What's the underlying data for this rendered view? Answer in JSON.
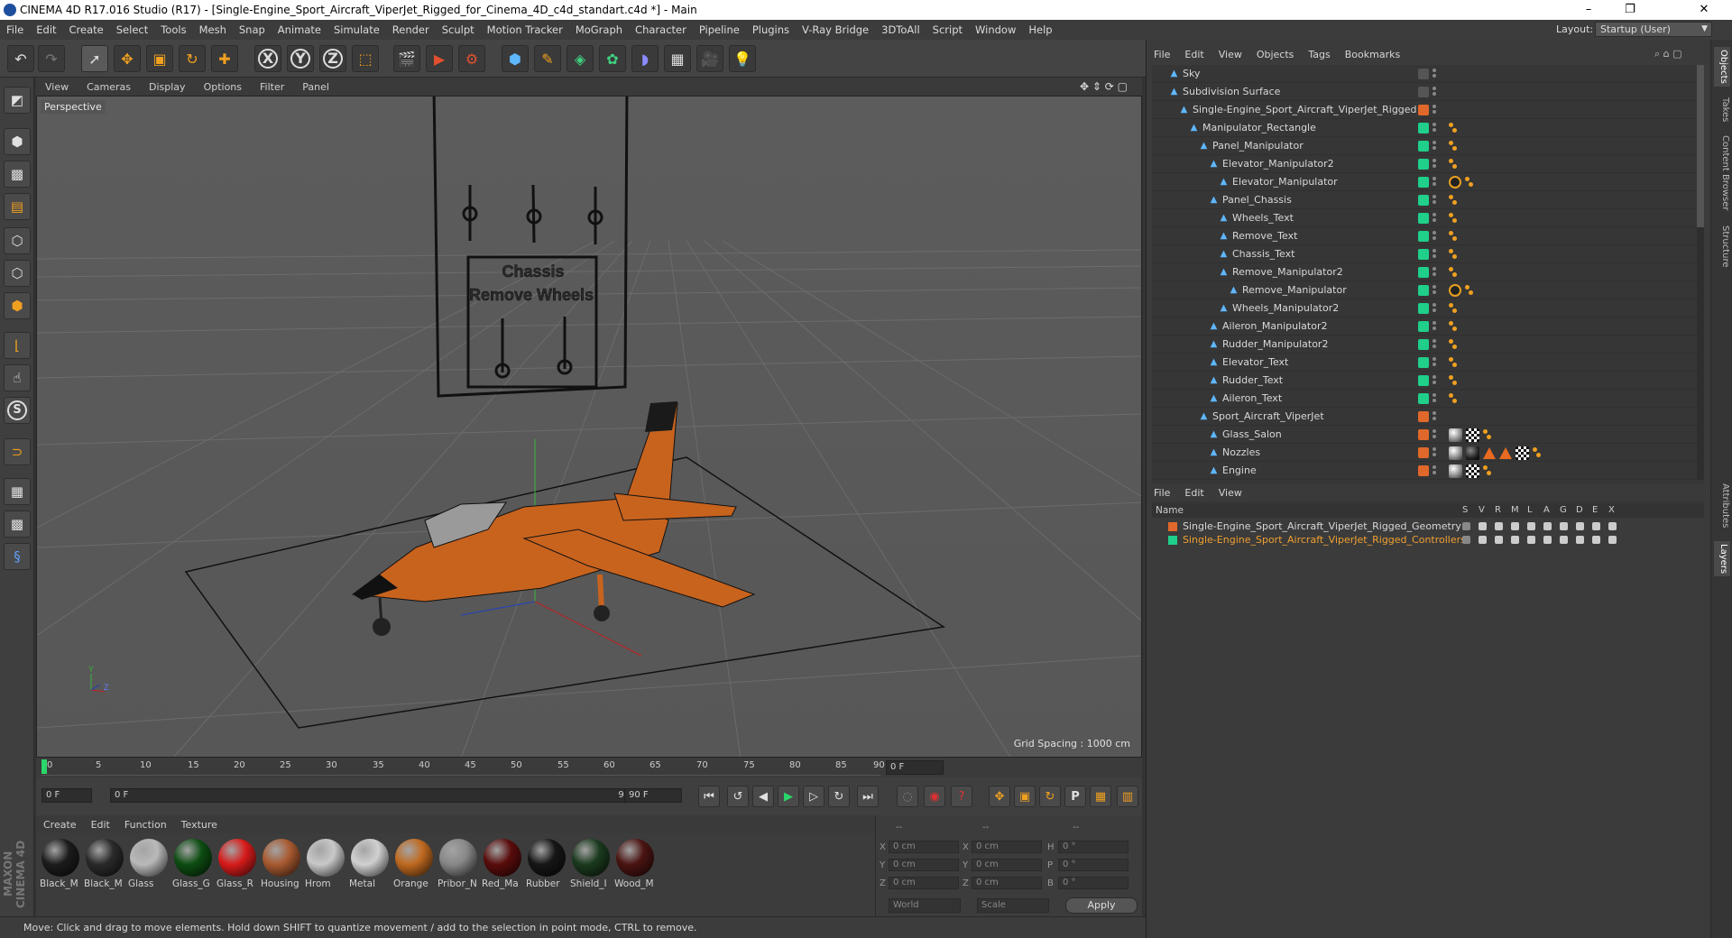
{
  "window": {
    "title": "CINEMA 4D R17.016 Studio (R17) - [Single-Engine_Sport_Aircraft_ViperJet_Rigged_for_Cinema_4D_c4d_standart.c4d *] - Main",
    "minimize": "–",
    "maximize": "❐",
    "close": "✕"
  },
  "menubar": [
    "File",
    "Edit",
    "Create",
    "Select",
    "Tools",
    "Mesh",
    "Snap",
    "Animate",
    "Simulate",
    "Render",
    "Sculpt",
    "Motion Tracker",
    "MoGraph",
    "Character",
    "Pipeline",
    "Plugins",
    "V-Ray Bridge",
    "3DToAll",
    "Script",
    "Window",
    "Help"
  ],
  "layout": {
    "label": "Layout:",
    "value": "Startup (User)"
  },
  "toolbar_icons": [
    "undo-icon",
    "redo-icon",
    "live-selection-icon",
    "move-icon",
    "scale-icon",
    "rotate-icon",
    "transform-icon",
    "x-axis-icon",
    "y-axis-icon",
    "z-axis-icon",
    "world-coords-icon",
    "render-view-icon",
    "render-picture-viewer-icon",
    "render-settings-icon",
    "cube-icon",
    "spline-pen-icon",
    "subdivision-icon",
    "array-icon",
    "deformer-icon",
    "floor-icon",
    "camera-icon",
    "light-icon"
  ],
  "toolbar_glyphs": {
    "x": "X",
    "y": "Y",
    "z": "Z"
  },
  "left_tools": [
    "make-editable-icon",
    "model-mode-icon",
    "texture-mode-icon",
    "workplane-icon",
    "point-mode-icon",
    "edge-mode-icon",
    "polygon-mode-icon",
    "axis-mode-icon",
    "tweak-mode-icon",
    "snap-icon",
    "magnet-icon",
    "grid-icon",
    "solo-icon",
    "python-icon"
  ],
  "left_glyphs": {
    "snap": "S"
  },
  "viewport": {
    "menu": [
      "View",
      "Cameras",
      "Display",
      "Options",
      "Filter",
      "Panel"
    ],
    "label": "Perspective",
    "grid_spacing": "Grid Spacing : 1000 cm",
    "panel_text": [
      "Chassis",
      "Remove  Wheels"
    ],
    "axis_labels": {
      "y": "Y",
      "z": "Z"
    }
  },
  "timeline": {
    "ticks": [
      "0",
      "5",
      "10",
      "15",
      "20",
      "25",
      "30",
      "35",
      "40",
      "45",
      "50",
      "55",
      "60",
      "65",
      "70",
      "75",
      "80",
      "85",
      "90"
    ],
    "current_frame": "0 F",
    "start": "0 F",
    "range_start": "0 F",
    "range_end": "90 F",
    "end": "90 F"
  },
  "transport_icons": [
    "goto-start-icon",
    "play-reverse-icon",
    "step-back-icon",
    "play-icon",
    "step-forward-icon",
    "loop-icon",
    "goto-end-icon",
    "keyframe-icon",
    "record-icon",
    "autokey-icon",
    "move-key-icon",
    "scale-key-icon",
    "rotate-key-icon",
    "param-key-icon",
    "pla-key-icon",
    "timeline-icon"
  ],
  "transport_glyphs": {
    "param": "P"
  },
  "materials": {
    "menu": [
      "Create",
      "Edit",
      "Function",
      "Texture"
    ],
    "items": [
      {
        "label": "Black_M",
        "color": "#1c1c1c"
      },
      {
        "label": "Black_M",
        "color": "#2a2a2a"
      },
      {
        "label": "Glass",
        "color": "#b9b9b9"
      },
      {
        "label": "Glass_G",
        "color": "#0d4d12"
      },
      {
        "label": "Glass_R",
        "color": "#d81b1b"
      },
      {
        "label": "Housing",
        "color": "#a85a30"
      },
      {
        "label": "Hrom",
        "color": "#c8c8c8"
      },
      {
        "label": "Metal",
        "color": "#d0d0d0"
      },
      {
        "label": "Orange",
        "color": "#c06a20"
      },
      {
        "label": "Pribor_N",
        "color": "#888888"
      },
      {
        "label": "Red_Ma",
        "color": "#5a0c0c"
      },
      {
        "label": "Rubber",
        "color": "#161616"
      },
      {
        "label": "Shield_I",
        "color": "#1b3a1e"
      },
      {
        "label": "Wood_M",
        "color": "#4a1412"
      }
    ]
  },
  "brand": {
    "logo": "MAXON CINEMA 4D"
  },
  "coordinates": {
    "header": [
      "--",
      "--",
      "--"
    ],
    "rows": [
      {
        "a": "X",
        "av": "0 cm",
        "b": "X",
        "bv": "0 cm",
        "c": "H",
        "cv": "0 °"
      },
      {
        "a": "Y",
        "av": "0 cm",
        "b": "Y",
        "bv": "0 cm",
        "c": "P",
        "cv": "0 °"
      },
      {
        "a": "Z",
        "av": "0 cm",
        "b": "Z",
        "bv": "0 cm",
        "c": "B",
        "cv": "0 °"
      }
    ],
    "mode1": "World",
    "mode2": "Scale",
    "apply": "Apply"
  },
  "status": "Move: Click and drag to move elements. Hold down SHIFT to quantize movement / add to the selection in point mode, CTRL to remove.",
  "objects": {
    "menu": [
      "File",
      "Edit",
      "View",
      "Objects",
      "Tags",
      "Bookmarks"
    ],
    "rows": [
      {
        "name": "Sky",
        "indent": 0,
        "layer": "#555555",
        "tags": []
      },
      {
        "name": "Subdivision Surface",
        "indent": 0,
        "layer": "#555555",
        "tags": []
      },
      {
        "name": "Single-Engine_Sport_Aircraft_ViperJet_Rigged",
        "indent": 1,
        "layer": "#e0682a",
        "tags": []
      },
      {
        "name": "Manipulator_Rectangle",
        "indent": 2,
        "layer": "#1fcf8a",
        "tags": [
          "dot"
        ]
      },
      {
        "name": "Panel_Manipulator",
        "indent": 3,
        "layer": "#1fcf8a",
        "tags": [
          "dot"
        ]
      },
      {
        "name": "Elevator_Manipulator2",
        "indent": 4,
        "layer": "#1fcf8a",
        "tags": [
          "dot"
        ]
      },
      {
        "name": "Elevator_Manipulator",
        "indent": 5,
        "layer": "#1fcf8a",
        "tags": [
          "no",
          "dot"
        ]
      },
      {
        "name": "Panel_Chassis",
        "indent": 4,
        "layer": "#1fcf8a",
        "tags": [
          "dot"
        ]
      },
      {
        "name": "Wheels_Text",
        "indent": 5,
        "layer": "#1fcf8a",
        "tags": [
          "dot"
        ]
      },
      {
        "name": "Remove_Text",
        "indent": 5,
        "layer": "#1fcf8a",
        "tags": [
          "dot"
        ]
      },
      {
        "name": "Chassis_Text",
        "indent": 5,
        "layer": "#1fcf8a",
        "tags": [
          "dot"
        ]
      },
      {
        "name": "Remove_Manipulator2",
        "indent": 5,
        "layer": "#1fcf8a",
        "tags": [
          "dot"
        ]
      },
      {
        "name": "Remove_Manipulator",
        "indent": 6,
        "layer": "#1fcf8a",
        "tags": [
          "no",
          "dot"
        ]
      },
      {
        "name": "Wheels_Manipulator2",
        "indent": 5,
        "layer": "#1fcf8a",
        "tags": [
          "dot"
        ]
      },
      {
        "name": "Aileron_Manipulator2",
        "indent": 4,
        "layer": "#1fcf8a",
        "tags": [
          "dot"
        ]
      },
      {
        "name": "Rudder_Manipulator2",
        "indent": 4,
        "layer": "#1fcf8a",
        "tags": [
          "dot"
        ]
      },
      {
        "name": "Elevator_Text",
        "indent": 4,
        "layer": "#1fcf8a",
        "tags": [
          "dot"
        ]
      },
      {
        "name": "Rudder_Text",
        "indent": 4,
        "layer": "#1fcf8a",
        "tags": [
          "dot"
        ]
      },
      {
        "name": "Aileron_Text",
        "indent": 4,
        "layer": "#1fcf8a",
        "tags": [
          "dot"
        ]
      },
      {
        "name": "Sport_Aircraft_ViperJet",
        "indent": 3,
        "layer": "#e0682a",
        "tags": []
      },
      {
        "name": "Glass_Salon",
        "indent": 4,
        "layer": "#e0682a",
        "tags": [
          "mat",
          "checker",
          "dot"
        ]
      },
      {
        "name": "Nozzles",
        "indent": 4,
        "layer": "#e0682a",
        "tags": [
          "mat",
          "matdark",
          "tri",
          "tri",
          "checker",
          "dot"
        ]
      },
      {
        "name": "Engine",
        "indent": 4,
        "layer": "#e0682a",
        "tags": [
          "mat",
          "checker",
          "dot"
        ]
      }
    ]
  },
  "side_tabs": [
    "Objects",
    "Takes",
    "Content Browser",
    "Structure"
  ],
  "side_tabs2": [
    "Attributes",
    "Layers"
  ],
  "layers": {
    "menu": [
      "File",
      "Edit",
      "View"
    ],
    "header_name": "Name",
    "header_flags": [
      "S",
      "V",
      "R",
      "M",
      "L",
      "A",
      "G",
      "D",
      "E",
      "X"
    ],
    "rows": [
      {
        "name": "Single-Engine_Sport_Aircraft_ViperJet_Rigged_Geometry",
        "color": "#e0682a",
        "text_color": "#d8d8d8"
      },
      {
        "name": "Single-Engine_Sport_Aircraft_ViperJet_Rigged_Controllers",
        "color": "#1fcf8a",
        "text_color": "#f0a030"
      }
    ]
  }
}
